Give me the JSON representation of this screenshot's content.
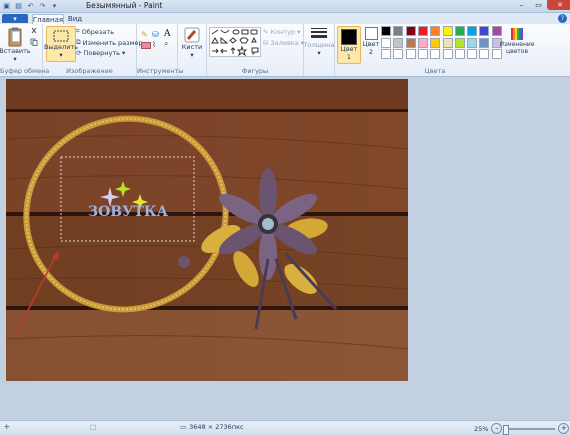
{
  "window": {
    "title": "Безымянный - Paint",
    "minimize": "–",
    "maximize": "▭",
    "close": "✕"
  },
  "tabs": {
    "file": "▾",
    "home": "Главная",
    "view": "Вид"
  },
  "groups": {
    "clipboard": {
      "label": "Буфер обмена",
      "paste": "Вставить"
    },
    "image": {
      "label": "Изображение",
      "select": "Выделить",
      "crop": "Обрезать",
      "resize": "Изменить размер",
      "rotate": "Повернуть"
    },
    "tools": {
      "label": "Инструменты"
    },
    "brushes": {
      "label": "Кисти"
    },
    "shapes": {
      "label": "Фигуры",
      "outline": "Контур",
      "fill": "Заливка"
    },
    "thickness": {
      "label": "Толщина"
    },
    "colors": {
      "label": "Цвета",
      "color1": "Цвет",
      "color1_num": "1",
      "color2": "Цвет",
      "color2_num": "2",
      "edit": "Изменение цветов",
      "color1_value": "#000000",
      "color2_value": "#ffffff",
      "palette": [
        "#000000",
        "#7f7f7f",
        "#880015",
        "#ed1c24",
        "#ff7f27",
        "#fff200",
        "#22b14c",
        "#00a2e8",
        "#3f48cc",
        "#a349a4",
        "#ffffff",
        "#c3c3c3",
        "#b97a57",
        "#ffaec9",
        "#ffc90e",
        "#efe4b0",
        "#b5e61d",
        "#99d9ea",
        "#7092be",
        "#c8bfe7",
        "#ffffff",
        "#ffffff",
        "#ffffff",
        "#ffffff",
        "#ffffff",
        "#ffffff",
        "#ffffff",
        "#ffffff",
        "#ffffff",
        "#ffffff"
      ]
    }
  },
  "canvas": {
    "watermark": "ЗОВУТКА"
  },
  "status": {
    "dimensions": "3648 × 2736пкс",
    "zoom": "25%"
  }
}
